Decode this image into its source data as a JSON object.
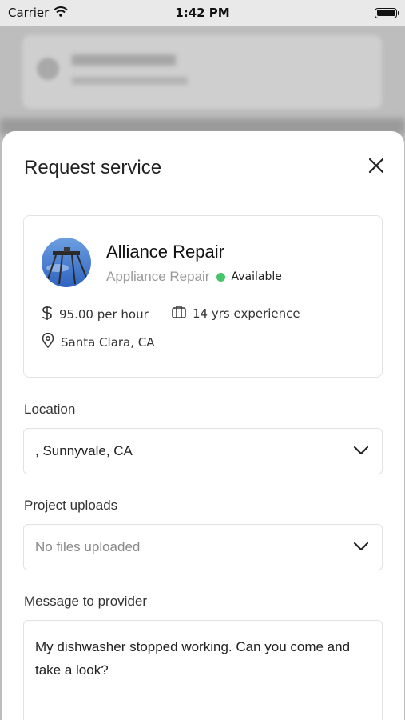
{
  "status_bar": {
    "carrier": "Carrier",
    "time": "1:42 PM"
  },
  "sheet": {
    "title": "Request service"
  },
  "provider": {
    "name": "Alliance Repair",
    "category": "Appliance Repair",
    "availability": "Available",
    "availability_color": "#45c46b",
    "rate": "95.00 per hour",
    "experience": "14 yrs experience",
    "location": "Santa Clara, CA"
  },
  "form": {
    "location_label": "Location",
    "location_value": ", Sunnyvale, CA",
    "uploads_label": "Project uploads",
    "uploads_value": "No files uploaded",
    "message_label": "Message to provider",
    "message_value": "My dishwasher stopped working. Can you come and take a look?"
  },
  "icons": [
    "wifi-icon",
    "battery-icon",
    "close-icon",
    "dollar-icon",
    "briefcase-icon",
    "map-pin-icon",
    "chevron-down-icon"
  ]
}
